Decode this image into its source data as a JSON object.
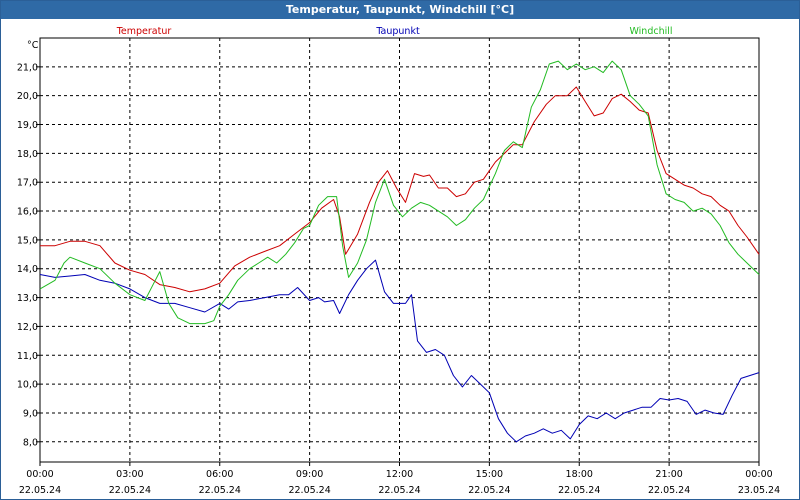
{
  "window": {
    "title": "Temperatur, Taupunkt, Windchill [°C]"
  },
  "chart_data": {
    "type": "line",
    "title": "Temperatur, Taupunkt, Windchill [°C]",
    "ylabel": "°C",
    "ylim": [
      7.3,
      22.0
    ],
    "yticks": [
      8.0,
      9.0,
      10.0,
      11.0,
      12.0,
      13.0,
      14.0,
      15.0,
      16.0,
      17.0,
      18.0,
      19.0,
      20.0,
      21.0
    ],
    "ytick_labels": [
      "8,0",
      "9,0",
      "10,0",
      "11,0",
      "12,0",
      "13,0",
      "14,0",
      "15,0",
      "16,0",
      "17,0",
      "18,0",
      "19,0",
      "20,0",
      "21,0"
    ],
    "xlim": [
      0,
      24
    ],
    "xticks": [
      {
        "x": 0,
        "time": "00:00",
        "date": "22.05.24"
      },
      {
        "x": 3,
        "time": "03:00",
        "date": "22.05.24"
      },
      {
        "x": 6,
        "time": "06:00",
        "date": "22.05.24"
      },
      {
        "x": 9,
        "time": "09:00",
        "date": "22.05.24"
      },
      {
        "x": 12,
        "time": "12:00",
        "date": "22.05.24"
      },
      {
        "x": 15,
        "time": "15:00",
        "date": "22.05.24"
      },
      {
        "x": 18,
        "time": "18:00",
        "date": "22.05.24"
      },
      {
        "x": 21,
        "time": "21:00",
        "date": "22.05.24"
      },
      {
        "x": 24,
        "time": "00:00",
        "date": "23.05.24"
      }
    ],
    "grid": true,
    "legend_position": "top",
    "series": [
      {
        "name": "Temperatur",
        "color": "#cc0000",
        "points": [
          [
            0,
            14.8
          ],
          [
            0.5,
            14.8
          ],
          [
            1.0,
            14.95
          ],
          [
            1.5,
            14.95
          ],
          [
            2.0,
            14.8
          ],
          [
            2.5,
            14.2
          ],
          [
            3.0,
            13.95
          ],
          [
            3.5,
            13.8
          ],
          [
            4.0,
            13.45
          ],
          [
            4.5,
            13.35
          ],
          [
            5.0,
            13.2
          ],
          [
            5.5,
            13.3
          ],
          [
            6.0,
            13.5
          ],
          [
            6.5,
            14.1
          ],
          [
            7.0,
            14.4
          ],
          [
            7.5,
            14.6
          ],
          [
            8.0,
            14.8
          ],
          [
            8.5,
            15.2
          ],
          [
            9.0,
            15.6
          ],
          [
            9.4,
            16.1
          ],
          [
            9.8,
            16.4
          ],
          [
            10.0,
            15.8
          ],
          [
            10.2,
            14.5
          ],
          [
            10.6,
            15.2
          ],
          [
            11.0,
            16.3
          ],
          [
            11.3,
            17.0
          ],
          [
            11.6,
            17.4
          ],
          [
            11.9,
            16.8
          ],
          [
            12.2,
            16.3
          ],
          [
            12.5,
            17.3
          ],
          [
            12.8,
            17.2
          ],
          [
            13.0,
            17.25
          ],
          [
            13.3,
            16.8
          ],
          [
            13.6,
            16.8
          ],
          [
            13.9,
            16.5
          ],
          [
            14.2,
            16.6
          ],
          [
            14.5,
            17.0
          ],
          [
            14.8,
            17.1
          ],
          [
            15.2,
            17.7
          ],
          [
            15.5,
            18.0
          ],
          [
            15.8,
            18.3
          ],
          [
            16.1,
            18.3
          ],
          [
            16.5,
            19.1
          ],
          [
            16.9,
            19.7
          ],
          [
            17.2,
            20.0
          ],
          [
            17.6,
            20.0
          ],
          [
            17.9,
            20.3
          ],
          [
            18.2,
            19.8
          ],
          [
            18.5,
            19.3
          ],
          [
            18.8,
            19.4
          ],
          [
            19.1,
            19.9
          ],
          [
            19.4,
            20.05
          ],
          [
            19.7,
            19.8
          ],
          [
            20.0,
            19.5
          ],
          [
            20.3,
            19.4
          ],
          [
            20.6,
            18.1
          ],
          [
            20.9,
            17.3
          ],
          [
            21.2,
            17.1
          ],
          [
            21.5,
            16.9
          ],
          [
            21.8,
            16.8
          ],
          [
            22.1,
            16.6
          ],
          [
            22.4,
            16.5
          ],
          [
            22.7,
            16.2
          ],
          [
            23.0,
            16.0
          ],
          [
            23.3,
            15.5
          ],
          [
            23.6,
            15.1
          ],
          [
            24.0,
            14.5
          ]
        ]
      },
      {
        "name": "Taupunkt",
        "color": "#0000b4",
        "points": [
          [
            0,
            13.8
          ],
          [
            0.5,
            13.7
          ],
          [
            1.0,
            13.75
          ],
          [
            1.5,
            13.8
          ],
          [
            2.0,
            13.6
          ],
          [
            2.5,
            13.5
          ],
          [
            3.0,
            13.3
          ],
          [
            3.5,
            13.0
          ],
          [
            4.0,
            12.8
          ],
          [
            4.5,
            12.8
          ],
          [
            5.0,
            12.65
          ],
          [
            5.5,
            12.5
          ],
          [
            6.0,
            12.8
          ],
          [
            6.3,
            12.6
          ],
          [
            6.6,
            12.85
          ],
          [
            7.0,
            12.9
          ],
          [
            7.5,
            13.0
          ],
          [
            8.0,
            13.1
          ],
          [
            8.3,
            13.1
          ],
          [
            8.6,
            13.35
          ],
          [
            9.0,
            12.9
          ],
          [
            9.3,
            13.0
          ],
          [
            9.5,
            12.85
          ],
          [
            9.8,
            12.9
          ],
          [
            10.0,
            12.45
          ],
          [
            10.3,
            13.1
          ],
          [
            10.6,
            13.6
          ],
          [
            10.9,
            14.0
          ],
          [
            11.2,
            14.3
          ],
          [
            11.5,
            13.2
          ],
          [
            11.8,
            12.8
          ],
          [
            12.2,
            12.8
          ],
          [
            12.4,
            13.1
          ],
          [
            12.6,
            11.5
          ],
          [
            12.9,
            11.1
          ],
          [
            13.2,
            11.2
          ],
          [
            13.5,
            11.0
          ],
          [
            13.8,
            10.3
          ],
          [
            14.1,
            9.9
          ],
          [
            14.4,
            10.3
          ],
          [
            14.7,
            10.0
          ],
          [
            15.0,
            9.7
          ],
          [
            15.3,
            8.8
          ],
          [
            15.6,
            8.3
          ],
          [
            15.9,
            8.0
          ],
          [
            16.2,
            8.2
          ],
          [
            16.5,
            8.3
          ],
          [
            16.8,
            8.45
          ],
          [
            17.1,
            8.3
          ],
          [
            17.4,
            8.4
          ],
          [
            17.7,
            8.1
          ],
          [
            18.0,
            8.6
          ],
          [
            18.3,
            8.9
          ],
          [
            18.6,
            8.8
          ],
          [
            18.9,
            9.0
          ],
          [
            19.2,
            8.8
          ],
          [
            19.5,
            9.0
          ],
          [
            19.8,
            9.1
          ],
          [
            20.1,
            9.2
          ],
          [
            20.4,
            9.2
          ],
          [
            20.7,
            9.5
          ],
          [
            21.0,
            9.45
          ],
          [
            21.3,
            9.5
          ],
          [
            21.6,
            9.4
          ],
          [
            21.9,
            8.95
          ],
          [
            22.2,
            9.1
          ],
          [
            22.5,
            9.0
          ],
          [
            22.8,
            8.95
          ],
          [
            23.1,
            9.6
          ],
          [
            23.4,
            10.2
          ],
          [
            23.7,
            10.3
          ],
          [
            24.0,
            10.4
          ]
        ]
      },
      {
        "name": "Windchill",
        "color": "#22bb22",
        "points": [
          [
            0,
            13.3
          ],
          [
            0.5,
            13.6
          ],
          [
            0.8,
            14.2
          ],
          [
            1.0,
            14.4
          ],
          [
            1.5,
            14.2
          ],
          [
            2.0,
            14.0
          ],
          [
            2.5,
            13.5
          ],
          [
            3.0,
            13.1
          ],
          [
            3.5,
            12.9
          ],
          [
            3.8,
            13.5
          ],
          [
            4.0,
            13.9
          ],
          [
            4.3,
            12.8
          ],
          [
            4.6,
            12.3
          ],
          [
            5.0,
            12.1
          ],
          [
            5.5,
            12.1
          ],
          [
            5.8,
            12.2
          ],
          [
            6.0,
            12.7
          ],
          [
            6.3,
            13.1
          ],
          [
            6.6,
            13.6
          ],
          [
            7.0,
            14.0
          ],
          [
            7.3,
            14.2
          ],
          [
            7.6,
            14.4
          ],
          [
            7.9,
            14.2
          ],
          [
            8.2,
            14.5
          ],
          [
            8.5,
            14.9
          ],
          [
            8.8,
            15.4
          ],
          [
            9.0,
            15.5
          ],
          [
            9.3,
            16.2
          ],
          [
            9.6,
            16.5
          ],
          [
            9.9,
            16.5
          ],
          [
            10.1,
            14.8
          ],
          [
            10.3,
            13.7
          ],
          [
            10.6,
            14.2
          ],
          [
            10.9,
            15.0
          ],
          [
            11.2,
            16.3
          ],
          [
            11.5,
            17.1
          ],
          [
            11.8,
            16.2
          ],
          [
            12.1,
            15.8
          ],
          [
            12.4,
            16.1
          ],
          [
            12.7,
            16.3
          ],
          [
            13.0,
            16.2
          ],
          [
            13.3,
            16.0
          ],
          [
            13.6,
            15.8
          ],
          [
            13.9,
            15.5
          ],
          [
            14.2,
            15.7
          ],
          [
            14.5,
            16.1
          ],
          [
            14.8,
            16.4
          ],
          [
            15.2,
            17.3
          ],
          [
            15.5,
            18.1
          ],
          [
            15.8,
            18.4
          ],
          [
            16.1,
            18.2
          ],
          [
            16.4,
            19.6
          ],
          [
            16.7,
            20.2
          ],
          [
            17.0,
            21.1
          ],
          [
            17.3,
            21.2
          ],
          [
            17.6,
            20.9
          ],
          [
            17.9,
            21.1
          ],
          [
            18.2,
            20.9
          ],
          [
            18.5,
            21.0
          ],
          [
            18.8,
            20.8
          ],
          [
            19.1,
            21.2
          ],
          [
            19.4,
            20.9
          ],
          [
            19.7,
            20.0
          ],
          [
            20.0,
            19.7
          ],
          [
            20.3,
            19.3
          ],
          [
            20.6,
            17.6
          ],
          [
            20.9,
            16.6
          ],
          [
            21.2,
            16.4
          ],
          [
            21.5,
            16.3
          ],
          [
            21.8,
            16.0
          ],
          [
            22.1,
            16.1
          ],
          [
            22.4,
            15.9
          ],
          [
            22.7,
            15.5
          ],
          [
            23.0,
            14.9
          ],
          [
            23.3,
            14.5
          ],
          [
            23.6,
            14.2
          ],
          [
            24.0,
            13.8
          ]
        ]
      }
    ]
  }
}
